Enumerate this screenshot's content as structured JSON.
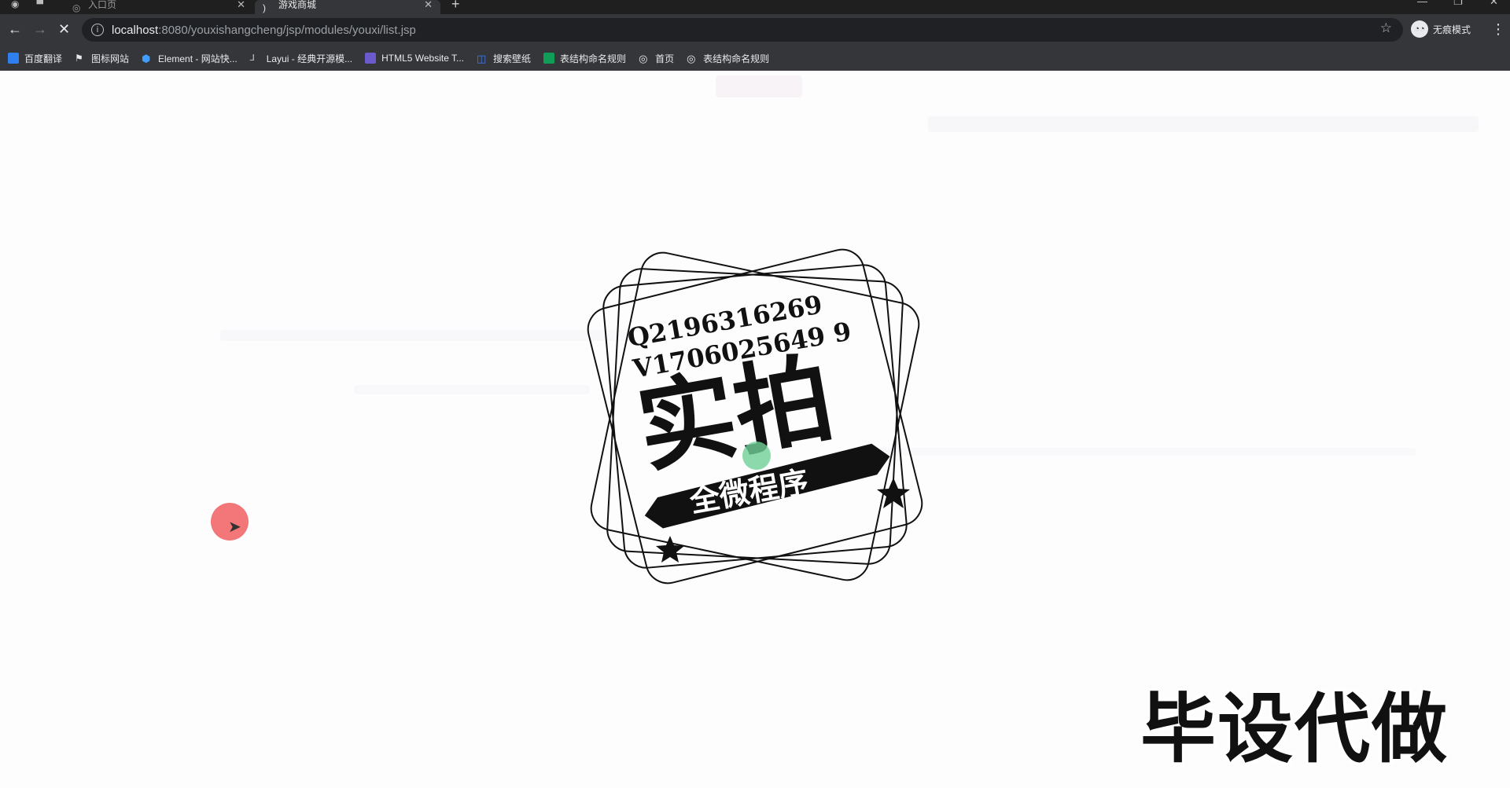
{
  "browser": {
    "tabs": [
      {
        "label": "入口页",
        "active": false
      },
      {
        "label": "游戏商城",
        "active": true
      }
    ],
    "new_tab": "+",
    "url": {
      "host": "localhost",
      "path": ":8080/youxishangcheng/jsp/modules/youxi/list.jsp"
    },
    "incognito_label": "无痕模式",
    "bookmarks": [
      {
        "label": "百度翻译",
        "icon": "baidu-translate-icon",
        "color": "#2f7ff0"
      },
      {
        "label": "图标网站",
        "icon": "flag-icon",
        "color": "#e8eaed"
      },
      {
        "label": "Element - 网站快...",
        "icon": "element-icon",
        "color": "#409eff"
      },
      {
        "label": "Layui - 经典开源模...",
        "icon": "layui-icon",
        "color": "#cccccc"
      },
      {
        "label": "HTML5 Website T...",
        "icon": "html5-icon",
        "color": "#6a5acd"
      },
      {
        "label": "搜索壁纸",
        "icon": "wallpaper-icon",
        "color": "#3d7cf5"
      },
      {
        "label": "表结构命名规则",
        "icon": "sheet-icon",
        "color": "#0f9d58"
      },
      {
        "label": "首页",
        "icon": "globe-icon",
        "color": "#e8eaed"
      },
      {
        "label": "表结构命名规则",
        "icon": "globe-icon",
        "color": "#e8eaed"
      }
    ]
  },
  "overlay": {
    "stamp_line1": "Q2196316269",
    "stamp_line2": "V1706025649 9",
    "stamp_big": "实拍",
    "stamp_banner": "全微程序",
    "watermark": "毕设代做"
  }
}
